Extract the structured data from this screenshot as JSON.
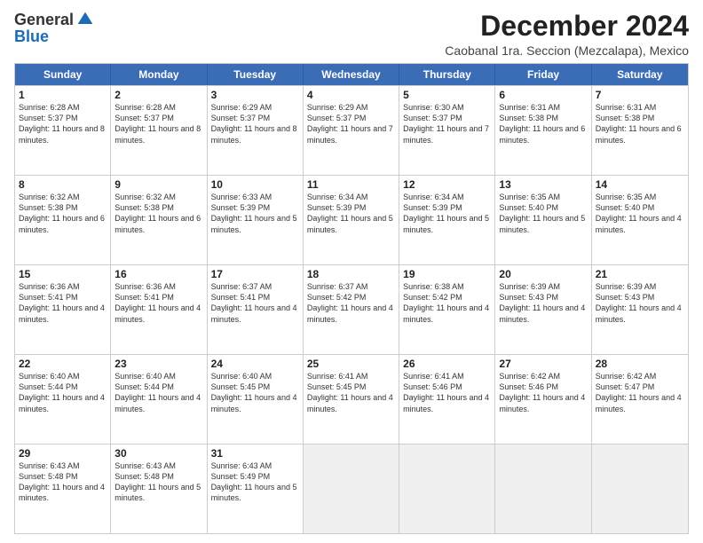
{
  "logo": {
    "general": "General",
    "blue": "Blue"
  },
  "title": "December 2024",
  "location": "Caobanal 1ra. Seccion (Mezcalapa), Mexico",
  "days": [
    "Sunday",
    "Monday",
    "Tuesday",
    "Wednesday",
    "Thursday",
    "Friday",
    "Saturday"
  ],
  "weeks": [
    [
      {
        "day": 1,
        "sunrise": "6:28 AM",
        "sunset": "5:37 PM",
        "daylight": "11 hours and 8 minutes"
      },
      {
        "day": 2,
        "sunrise": "6:28 AM",
        "sunset": "5:37 PM",
        "daylight": "11 hours and 8 minutes"
      },
      {
        "day": 3,
        "sunrise": "6:29 AM",
        "sunset": "5:37 PM",
        "daylight": "11 hours and 8 minutes"
      },
      {
        "day": 4,
        "sunrise": "6:29 AM",
        "sunset": "5:37 PM",
        "daylight": "11 hours and 7 minutes"
      },
      {
        "day": 5,
        "sunrise": "6:30 AM",
        "sunset": "5:37 PM",
        "daylight": "11 hours and 7 minutes"
      },
      {
        "day": 6,
        "sunrise": "6:31 AM",
        "sunset": "5:38 PM",
        "daylight": "11 hours and 6 minutes"
      },
      {
        "day": 7,
        "sunrise": "6:31 AM",
        "sunset": "5:38 PM",
        "daylight": "11 hours and 6 minutes"
      }
    ],
    [
      {
        "day": 8,
        "sunrise": "6:32 AM",
        "sunset": "5:38 PM",
        "daylight": "11 hours and 6 minutes"
      },
      {
        "day": 9,
        "sunrise": "6:32 AM",
        "sunset": "5:38 PM",
        "daylight": "11 hours and 6 minutes"
      },
      {
        "day": 10,
        "sunrise": "6:33 AM",
        "sunset": "5:39 PM",
        "daylight": "11 hours and 5 minutes"
      },
      {
        "day": 11,
        "sunrise": "6:34 AM",
        "sunset": "5:39 PM",
        "daylight": "11 hours and 5 minutes"
      },
      {
        "day": 12,
        "sunrise": "6:34 AM",
        "sunset": "5:39 PM",
        "daylight": "11 hours and 5 minutes"
      },
      {
        "day": 13,
        "sunrise": "6:35 AM",
        "sunset": "5:40 PM",
        "daylight": "11 hours and 5 minutes"
      },
      {
        "day": 14,
        "sunrise": "6:35 AM",
        "sunset": "5:40 PM",
        "daylight": "11 hours and 4 minutes"
      }
    ],
    [
      {
        "day": 15,
        "sunrise": "6:36 AM",
        "sunset": "5:41 PM",
        "daylight": "11 hours and 4 minutes"
      },
      {
        "day": 16,
        "sunrise": "6:36 AM",
        "sunset": "5:41 PM",
        "daylight": "11 hours and 4 minutes"
      },
      {
        "day": 17,
        "sunrise": "6:37 AM",
        "sunset": "5:41 PM",
        "daylight": "11 hours and 4 minutes"
      },
      {
        "day": 18,
        "sunrise": "6:37 AM",
        "sunset": "5:42 PM",
        "daylight": "11 hours and 4 minutes"
      },
      {
        "day": 19,
        "sunrise": "6:38 AM",
        "sunset": "5:42 PM",
        "daylight": "11 hours and 4 minutes"
      },
      {
        "day": 20,
        "sunrise": "6:39 AM",
        "sunset": "5:43 PM",
        "daylight": "11 hours and 4 minutes"
      },
      {
        "day": 21,
        "sunrise": "6:39 AM",
        "sunset": "5:43 PM",
        "daylight": "11 hours and 4 minutes"
      }
    ],
    [
      {
        "day": 22,
        "sunrise": "6:40 AM",
        "sunset": "5:44 PM",
        "daylight": "11 hours and 4 minutes"
      },
      {
        "day": 23,
        "sunrise": "6:40 AM",
        "sunset": "5:44 PM",
        "daylight": "11 hours and 4 minutes"
      },
      {
        "day": 24,
        "sunrise": "6:40 AM",
        "sunset": "5:45 PM",
        "daylight": "11 hours and 4 minutes"
      },
      {
        "day": 25,
        "sunrise": "6:41 AM",
        "sunset": "5:45 PM",
        "daylight": "11 hours and 4 minutes"
      },
      {
        "day": 26,
        "sunrise": "6:41 AM",
        "sunset": "5:46 PM",
        "daylight": "11 hours and 4 minutes"
      },
      {
        "day": 27,
        "sunrise": "6:42 AM",
        "sunset": "5:46 PM",
        "daylight": "11 hours and 4 minutes"
      },
      {
        "day": 28,
        "sunrise": "6:42 AM",
        "sunset": "5:47 PM",
        "daylight": "11 hours and 4 minutes"
      }
    ],
    [
      {
        "day": 29,
        "sunrise": "6:43 AM",
        "sunset": "5:48 PM",
        "daylight": "11 hours and 4 minutes"
      },
      {
        "day": 30,
        "sunrise": "6:43 AM",
        "sunset": "5:48 PM",
        "daylight": "11 hours and 5 minutes"
      },
      {
        "day": 31,
        "sunrise": "6:43 AM",
        "sunset": "5:49 PM",
        "daylight": "11 hours and 5 minutes"
      },
      null,
      null,
      null,
      null
    ]
  ]
}
